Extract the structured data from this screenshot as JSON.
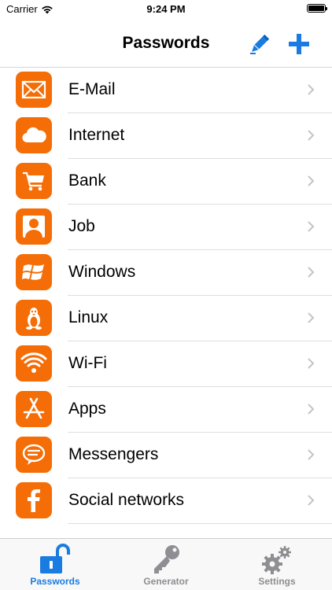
{
  "status_bar": {
    "carrier": "Carrier",
    "time": "9:24 PM"
  },
  "nav": {
    "title": "Passwords",
    "edit_icon": "pencil-icon",
    "add_icon": "plus-icon"
  },
  "colors": {
    "accent": "#1a7ce0",
    "category_icon_bg": "#f46d06",
    "inactive_tab": "#8e8e93"
  },
  "categories": [
    {
      "label": "E-Mail",
      "icon": "envelope-icon"
    },
    {
      "label": "Internet",
      "icon": "cloud-icon"
    },
    {
      "label": "Bank",
      "icon": "cart-icon"
    },
    {
      "label": "Job",
      "icon": "person-icon"
    },
    {
      "label": "Windows",
      "icon": "windows-logo-icon"
    },
    {
      "label": "Linux",
      "icon": "penguin-icon"
    },
    {
      "label": "Wi-Fi",
      "icon": "wifi-icon"
    },
    {
      "label": "Apps",
      "icon": "app-store-icon"
    },
    {
      "label": "Messengers",
      "icon": "chat-bubble-icon"
    },
    {
      "label": "Social networks",
      "icon": "facebook-f-icon"
    }
  ],
  "tabs": [
    {
      "label": "Passwords",
      "icon": "unlocked-padlock-icon",
      "active": true
    },
    {
      "label": "Generator",
      "icon": "key-icon",
      "active": false
    },
    {
      "label": "Settings",
      "icon": "gears-icon",
      "active": false
    }
  ]
}
